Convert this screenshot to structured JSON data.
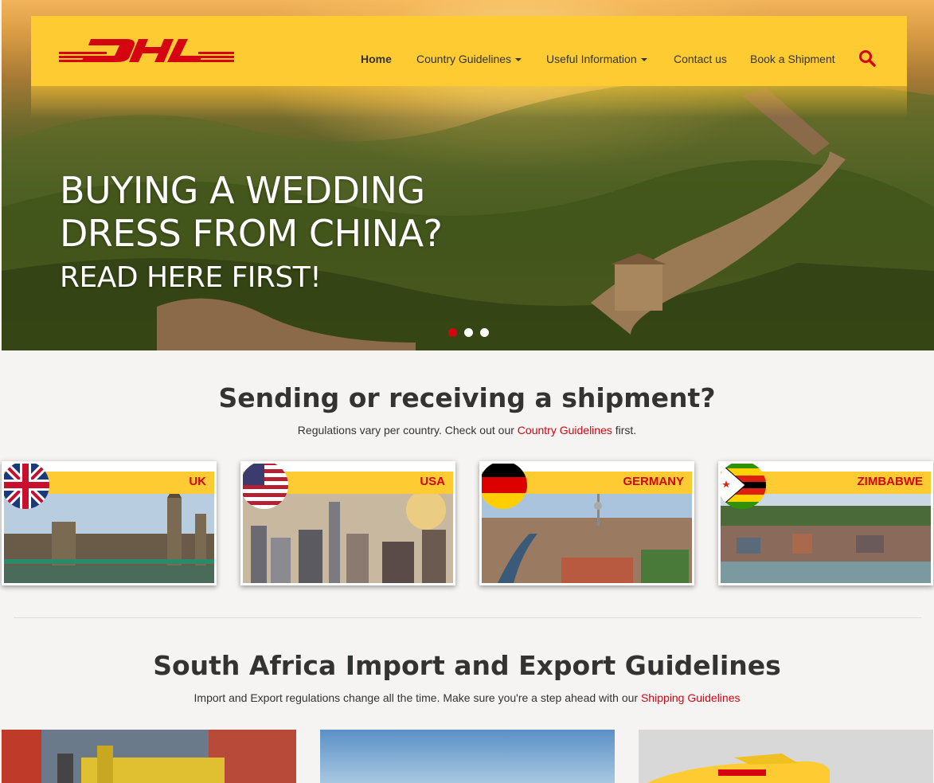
{
  "header": {
    "brand": "DHL",
    "nav": [
      {
        "label": "Home",
        "active": true
      },
      {
        "label": "Country Guidelines",
        "dropdown": true
      },
      {
        "label": "Useful Information",
        "dropdown": true
      },
      {
        "label": "Contact us"
      },
      {
        "label": "Book a Shipment"
      }
    ],
    "search_icon": "search-icon"
  },
  "hero": {
    "title_line1": "BUYING A WEDDING",
    "title_line2": "DRESS FROM CHINA?",
    "subtitle": "READ HERE FIRST!",
    "slides": 3,
    "active_slide": 1
  },
  "shipment": {
    "title": "Sending or receiving a shipment?",
    "subtitle_before": "Regulations vary per country. Check out our ",
    "subtitle_link": "Country Guidelines",
    "subtitle_after": " first.",
    "countries": [
      {
        "name": "UK"
      },
      {
        "name": "USA"
      },
      {
        "name": "GERMANY"
      },
      {
        "name": "ZIMBABWE"
      }
    ]
  },
  "guidelines": {
    "title": "South Africa Import and Export Guidelines",
    "subtitle_before": "Import and Export regulations change all the time. Make sure you're a step ahead with our ",
    "subtitle_link": "Shipping Guidelines"
  },
  "colors": {
    "brand_yellow": "#fecc32",
    "brand_red": "#d40511"
  }
}
